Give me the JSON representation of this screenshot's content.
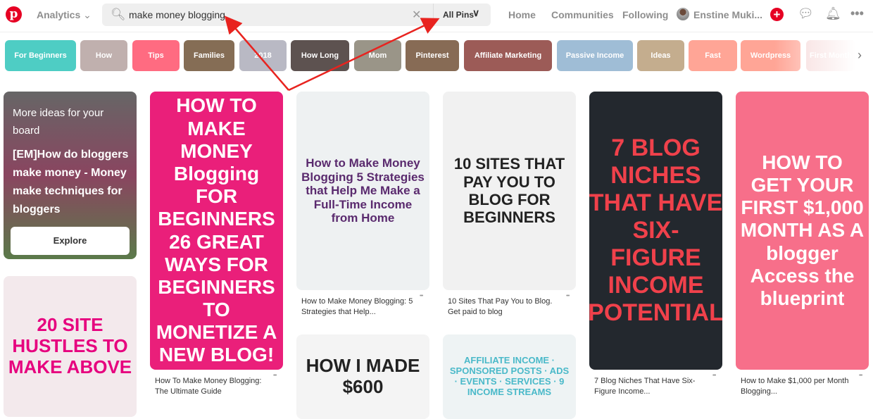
{
  "header": {
    "analytics": "Analytics",
    "search_query": "make money blogging",
    "search_scope": "All Pins",
    "nav": [
      "Home",
      "Communities",
      "Following"
    ],
    "user": "Enstine Muki..."
  },
  "chips": [
    {
      "label": "For Beginners",
      "color": "#4ecdc4"
    },
    {
      "label": "How",
      "color": "#c0b0ae"
    },
    {
      "label": "Tips",
      "color": "#ff6b81"
    },
    {
      "label": "Families",
      "color": "#856d55"
    },
    {
      "label": "2018",
      "color": "#b9b9c4"
    },
    {
      "label": "How Long",
      "color": "#5d5250"
    },
    {
      "label": "Mom",
      "color": "#9a9588"
    },
    {
      "label": "Pinterest",
      "color": "#876b55"
    },
    {
      "label": "Affiliate Marketing",
      "color": "#9c5b57"
    },
    {
      "label": "Passive Income",
      "color": "#9fbdd6"
    },
    {
      "label": "Ideas",
      "color": "#c4ad8e"
    },
    {
      "label": "Fast",
      "color": "#ffa596"
    },
    {
      "label": "Wordpress",
      "color": "#ffa596"
    },
    {
      "label": "First Month",
      "color": "#f5d6d6"
    }
  ],
  "board_card": {
    "heading": "More ideas for your board",
    "title": "[EM]How do bloggers make money - Money make techniques for bloggers",
    "button": "Explore"
  },
  "pins": [
    {
      "image_text": "20 SITE HUSTLES TO MAKE ABOVE",
      "bg": "#f3e9ec",
      "fg": "#e6007e",
      "caption": ""
    },
    {
      "image_text": "HOW TO MAKE MONEY Blogging FOR BEGINNERS 26 GREAT WAYS FOR BEGINNERS TO MONETIZE A NEW BLOG!",
      "bg": "#ea1f7a",
      "fg": "#ffffff",
      "caption": "How To Make Money Blogging: The Ultimate Guide"
    },
    {
      "image_text": "How to Make Money Blogging 5 Strategies that Help Me Make a Full-Time Income from Home",
      "bg": "#eef1f2",
      "fg": "#5a2a6e",
      "caption": "How to Make Money Blogging: 5 Strategies that Help..."
    },
    {
      "image_text": "HOW I MADE $600",
      "bg": "#f4f4f4",
      "fg": "#222222",
      "caption": ""
    },
    {
      "image_text": "10 SITES THAT PAY YOU TO BLOG FOR BEGINNERS",
      "bg": "#f1f1f1",
      "fg": "#222222",
      "caption": "10 Sites That Pay You to Blog. Get paid to blog"
    },
    {
      "image_text": "AFFILIATE INCOME · SPONSORED POSTS · ADS · EVENTS · SERVICES · 9 INCOME STREAMS",
      "bg": "#eef3f4",
      "fg": "#4ab9c9",
      "caption": ""
    },
    {
      "image_text": "7 BLOG NICHES THAT HAVE SIX-FIGURE INCOME POTENTIAL",
      "bg": "#23282e",
      "fg": "#f0414b",
      "caption": "7 Blog Niches That Have Six-Figure Income..."
    },
    {
      "image_text": "HOW TO GET YOUR FIRST $1,000 MONTH AS A blogger Access the blueprint",
      "bg": "#f76f8a",
      "fg": "#ffffff",
      "caption": "How to Make $1,000 per Month Blogging..."
    }
  ],
  "colors": {
    "brand": "#e60023",
    "annotation": "#e8231f"
  }
}
